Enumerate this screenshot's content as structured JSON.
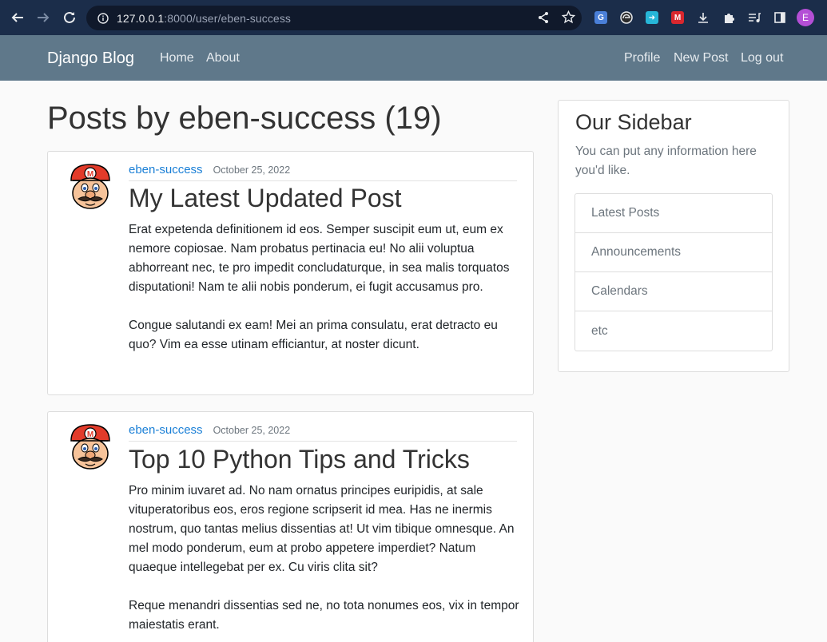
{
  "browser": {
    "url_host": "127.0.0.1",
    "url_path": ":8000/user/eben-success",
    "profile_initial": "E"
  },
  "navbar": {
    "brand": "Django Blog",
    "left_links": [
      "Home",
      "About"
    ],
    "right_links": [
      "Profile",
      "New Post",
      "Log out"
    ]
  },
  "page_title": "Posts by eben-success (19)",
  "posts": [
    {
      "author": "eben-success",
      "date": "October 25, 2022",
      "title": "My Latest Updated Post",
      "paragraphs": [
        "Erat expetenda definitionem id eos. Semper suscipit eum ut, eum ex nemore copiosae. Nam probatus pertinacia eu! No alii voluptua abhorreant nec, te pro impedit concludaturque, in sea malis torquatos disputationi! Nam te alii nobis ponderum, ei fugit accusamus pro.",
        "Congue salutandi ex eam! Mei an prima consulatu, erat detracto eu quo? Vim ea esse utinam efficiantur, at noster dicunt."
      ]
    },
    {
      "author": "eben-success",
      "date": "October 25, 2022",
      "title": "Top 10 Python Tips and Tricks",
      "paragraphs": [
        "Pro minim iuvaret ad. No nam ornatus principes euripidis, at sale vituperatoribus eos, eros regione scripserit id mea. Has ne inermis nostrum, quo tantas melius dissentias at! Ut vim tibique omnesque. An mel modo ponderum, eum at probo appetere imperdiet? Natum quaeque intellegebat per ex. Cu viris clita sit?",
        "Reque menandri dissentias sed ne, no tota nonumes eos, vix in tempor maiestatis erant."
      ]
    }
  ],
  "sidebar": {
    "title": "Our Sidebar",
    "text": "You can put any information here you'd like.",
    "items": [
      "Latest Posts",
      "Announcements",
      "Calendars",
      "etc"
    ]
  }
}
